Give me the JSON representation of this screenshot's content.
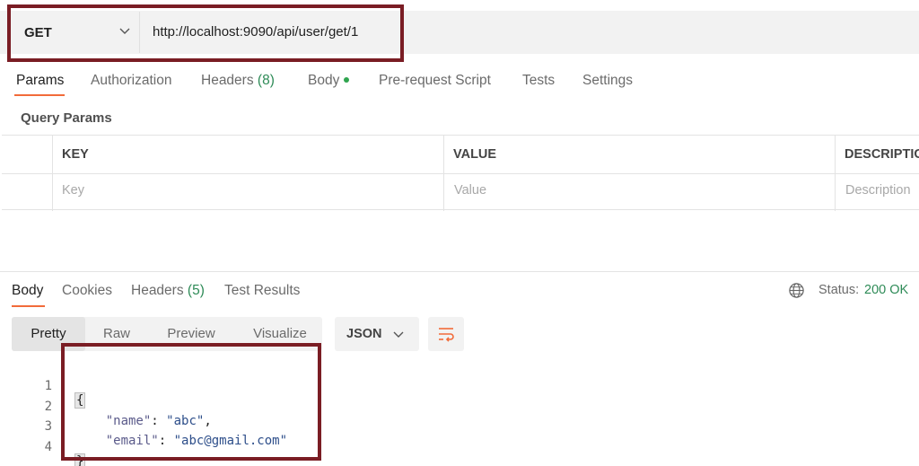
{
  "request": {
    "method": "GET",
    "url": "http://localhost:9090/api/user/get/1"
  },
  "request_tabs": {
    "params": "Params",
    "authorization": "Authorization",
    "headers": "Headers",
    "headers_count": "(8)",
    "body": "Body",
    "pre_request_script": "Pre-request Script",
    "tests": "Tests",
    "settings": "Settings",
    "active": "Params"
  },
  "query_params": {
    "title": "Query Params",
    "columns": [
      "KEY",
      "VALUE",
      "DESCRIPTIC"
    ],
    "placeholders": [
      "Key",
      "Value",
      "Description"
    ]
  },
  "response_tabs": {
    "body": "Body",
    "cookies": "Cookies",
    "headers": "Headers",
    "headers_count": "(5)",
    "test_results": "Test Results",
    "active": "Body"
  },
  "status": {
    "label": "Status:",
    "value": "200 OK",
    "color": "#2e8b57"
  },
  "view_modes": {
    "options": [
      "Pretty",
      "Raw",
      "Preview",
      "Visualize"
    ],
    "active": "Pretty"
  },
  "format": {
    "selected": "JSON"
  },
  "response_body": {
    "line_numbers": [
      "1",
      "2",
      "3",
      "4"
    ],
    "open_brace": "{",
    "close_brace": "}",
    "name_key": "\"name\"",
    "name_value": "\"abc\"",
    "email_key": "\"email\"",
    "email_value": "\"abc@gmail.com\""
  },
  "colors": {
    "accent": "#f26b3a",
    "highlight_border": "#7a1d24",
    "success": "#2e8b57",
    "body_dot": "#2fa44f"
  },
  "icons": [
    "chevron-down-icon",
    "globe-icon",
    "wrap-lines-icon"
  ]
}
